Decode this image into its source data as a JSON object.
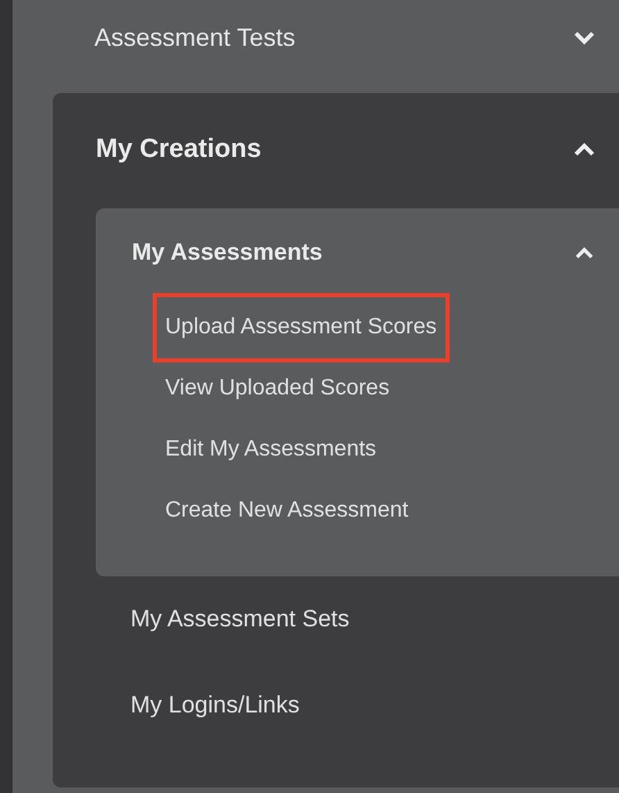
{
  "top_item": {
    "label": "Assessment Tests",
    "expanded": false
  },
  "section": {
    "title": "My Creations",
    "expanded": true,
    "group": {
      "title": "My Assessments",
      "expanded": true,
      "items": [
        {
          "label": "Upload Assessment Scores",
          "highlighted": true
        },
        {
          "label": "View Uploaded Scores",
          "highlighted": false
        },
        {
          "label": "Edit My Assessments",
          "highlighted": false
        },
        {
          "label": "Create New Assessment",
          "highlighted": false
        }
      ]
    },
    "links": [
      "My Assessment Sets",
      "My Logins/Links"
    ]
  }
}
